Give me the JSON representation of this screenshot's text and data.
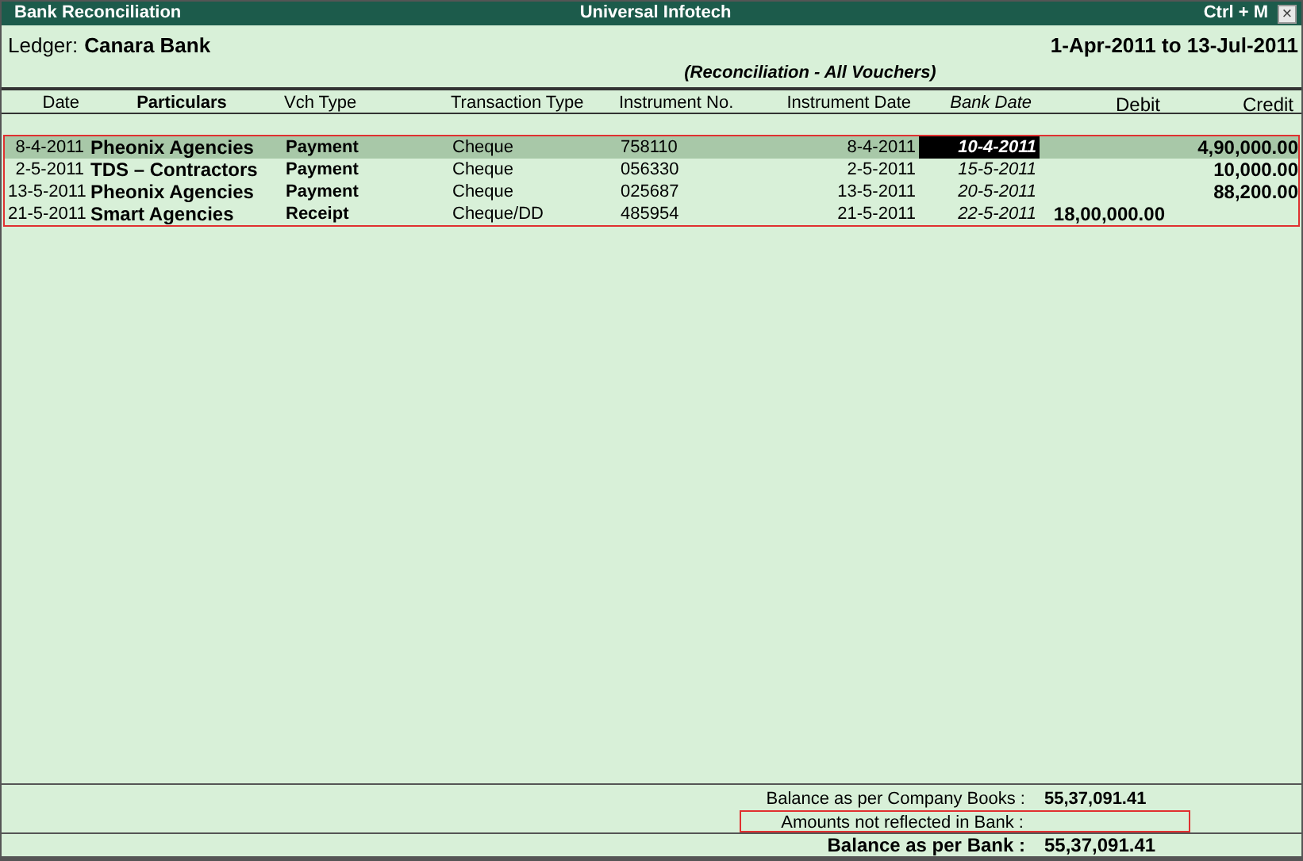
{
  "window": {
    "title": "Bank Reconciliation",
    "company": "Universal Infotech",
    "shortcut": "Ctrl + M",
    "close": "×"
  },
  "ledger": {
    "label": "Ledger:",
    "name": "Canara Bank",
    "period": "1-Apr-2011 to 13-Jul-2011"
  },
  "subtitle": "(Reconciliation - All Vouchers)",
  "columns": [
    "Date",
    "Particulars",
    "Vch Type",
    "Transaction Type",
    "Instrument No.",
    "Instrument Date",
    "Bank Date",
    "Debit",
    "Credit"
  ],
  "rows": [
    {
      "date": "8-4-2011",
      "particulars": "Pheonix Agencies",
      "vch_type": "Payment",
      "transaction_type": "Cheque",
      "instrument_no": "758110",
      "instrument_date": "8-4-2011",
      "bank_date": "10-4-2011",
      "credit": "4,90,000.00",
      "selected": true
    },
    {
      "date": "2-5-2011",
      "particulars": "TDS – Contractors",
      "vch_type": "Payment",
      "transaction_type": "Cheque",
      "instrument_no": "056330",
      "instrument_date": "2-5-2011",
      "bank_date": "15-5-2011",
      "credit": "10,000.00",
      "selected": false
    },
    {
      "date": "13-5-2011",
      "particulars": "Pheonix Agencies",
      "vch_type": "Payment",
      "transaction_type": "Cheque",
      "instrument_no": "025687",
      "instrument_date": "13-5-2011",
      "bank_date": "20-5-2011",
      "credit": "88,200.00",
      "selected": false
    },
    {
      "date": "21-5-2011",
      "particulars": "Smart Agencies",
      "vch_type": "Receipt",
      "transaction_type": "Cheque/DD",
      "instrument_no": "485954",
      "instrument_date": "21-5-2011",
      "bank_date": "22-5-2011",
      "debit": "18,00,000.00",
      "selected": false
    }
  ],
  "summary": [
    {
      "label": "Balance as per Company Books :",
      "value": "55,37,091.41",
      "bold": false,
      "highlighted": false
    },
    {
      "label": "Amounts not reflected in Bank :",
      "bold": false,
      "highlighted": true
    },
    {
      "label": "Balance as per Bank :",
      "value": "55,37,091.41",
      "bold": true,
      "highlighted": false
    }
  ]
}
